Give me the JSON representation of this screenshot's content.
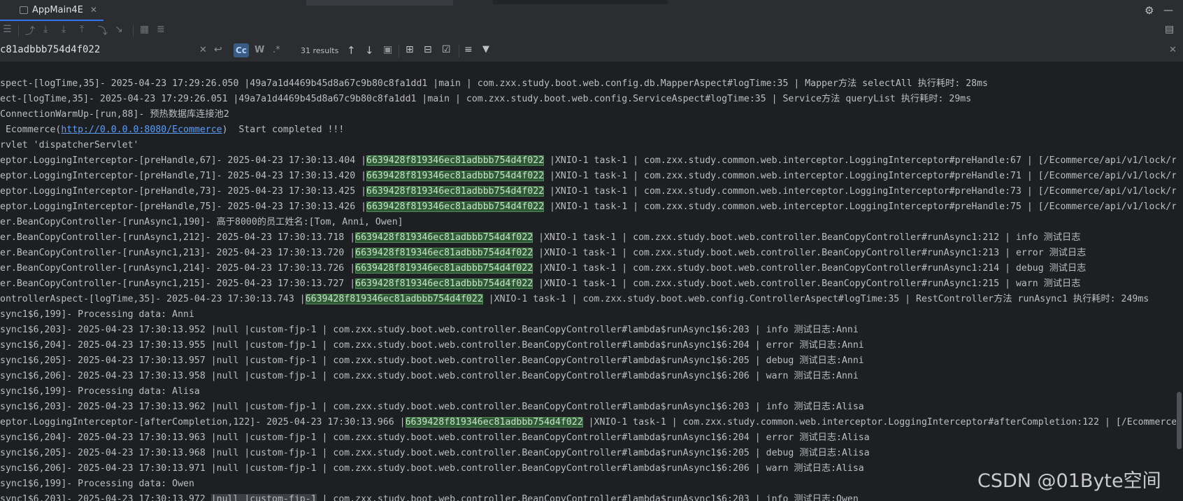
{
  "tab": {
    "title": "AppMain4E",
    "close": "✕"
  },
  "find": {
    "query": "c81adbbb754d4f022",
    "case_sensitive_label": "Cc",
    "words_label": "W",
    "regex_label": ".*",
    "results": "31 results"
  },
  "console": {
    "lines": [
      {
        "pre": "spect-[logTime,35]- 2025-04-23 17:29:26.050 |49a7a1d4469b45d8a67c9b80c8fa1dd1 |main | com.zxx.study.boot.web.config.db.MapperAspect#logTime:35 | Mapper方法 selectAll 执行耗时: 28ms"
      },
      {
        "pre": "ect-[logTime,35]- 2025-04-23 17:29:26.051 |49a7a1d4469b45d8a67c9b80c8fa1dd1 |main | com.zxx.study.boot.web.config.ServiceAspect#logTime:35 | Service方法 queryList 执行耗时: 29ms"
      },
      {
        "pre": "ConnectionWarmUp-[run,88]- 预热数据库连接池2"
      },
      {
        "pre": " Ecommerce(",
        "link": "http://0.0.0.0:8080/Ecommerce",
        "post": ")  Start completed !!!"
      },
      {
        "pre": "rvlet 'dispatcherServlet'"
      },
      {
        "pre": "eptor.LoggingInterceptor-[preHandle,67]- 2025-04-23 17:30:13.404 |",
        "hl": "6639428f819346ec81adbbb754d4f022",
        "post": " |XNIO-1 task-1 | com.zxx.study.common.web.interceptor.LoggingInterceptor#preHandle:67 | [/Ecommerce/api/v1/lock/r"
      },
      {
        "pre": "eptor.LoggingInterceptor-[preHandle,71]- 2025-04-23 17:30:13.420 |",
        "hl": "6639428f819346ec81adbbb754d4f022",
        "post": " |XNIO-1 task-1 | com.zxx.study.common.web.interceptor.LoggingInterceptor#preHandle:71 | [/Ecommerce/api/v1/lock/r"
      },
      {
        "pre": "eptor.LoggingInterceptor-[preHandle,73]- 2025-04-23 17:30:13.425 |",
        "hl": "6639428f819346ec81adbbb754d4f022",
        "post": " |XNIO-1 task-1 | com.zxx.study.common.web.interceptor.LoggingInterceptor#preHandle:73 | [/Ecommerce/api/v1/lock/r"
      },
      {
        "pre": "eptor.LoggingInterceptor-[preHandle,75]- 2025-04-23 17:30:13.426 |",
        "hl": "6639428f819346ec81adbbb754d4f022",
        "post": " |XNIO-1 task-1 | com.zxx.study.common.web.interceptor.LoggingInterceptor#preHandle:75 | [/Ecommerce/api/v1/lock/r"
      },
      {
        "pre": "er.BeanCopyController-[runAsync1,190]- 高于8000的员工姓名:[Tom, Anni, Owen]"
      },
      {
        "pre": "er.BeanCopyController-[runAsync1,212]- 2025-04-23 17:30:13.718 |",
        "hl": "6639428f819346ec81adbbb754d4f022",
        "post": " |XNIO-1 task-1 | com.zxx.study.boot.web.controller.BeanCopyController#runAsync1:212 | info 测试日志"
      },
      {
        "pre": "er.BeanCopyController-[runAsync1,213]- 2025-04-23 17:30:13.720 |",
        "hl": "6639428f819346ec81adbbb754d4f022",
        "post": " |XNIO-1 task-1 | com.zxx.study.boot.web.controller.BeanCopyController#runAsync1:213 | error 测试日志"
      },
      {
        "pre": "er.BeanCopyController-[runAsync1,214]- 2025-04-23 17:30:13.726 |",
        "hl": "6639428f819346ec81adbbb754d4f022",
        "post": " |XNIO-1 task-1 | com.zxx.study.boot.web.controller.BeanCopyController#runAsync1:214 | debug 测试日志"
      },
      {
        "pre": "er.BeanCopyController-[runAsync1,215]- 2025-04-23 17:30:13.727 |",
        "hl": "6639428f819346ec81adbbb754d4f022",
        "post": " |XNIO-1 task-1 | com.zxx.study.boot.web.controller.BeanCopyController#runAsync1:215 | warn 测试日志"
      },
      {
        "pre": "ontrollerAspect-[logTime,35]- 2025-04-23 17:30:13.743 |",
        "hl": "6639428f819346ec81adbbb754d4f022",
        "post": " |XNIO-1 task-1 | com.zxx.study.boot.web.config.ControllerAspect#logTime:35 | RestController方法 runAsync1 执行耗时: 249ms"
      },
      {
        "pre": "sync1$6,199]- Processing data: Anni"
      },
      {
        "pre": "sync1$6,203]- 2025-04-23 17:30:13.952 |null |custom-fjp-1 | com.zxx.study.boot.web.controller.BeanCopyController#lambda$runAsync1$6:203 | info 测试日志:Anni"
      },
      {
        "pre": "sync1$6,204]- 2025-04-23 17:30:13.955 |null |custom-fjp-1 | com.zxx.study.boot.web.controller.BeanCopyController#lambda$runAsync1$6:204 | error 测试日志:Anni"
      },
      {
        "pre": "sync1$6,205]- 2025-04-23 17:30:13.957 |null |custom-fjp-1 | com.zxx.study.boot.web.controller.BeanCopyController#lambda$runAsync1$6:205 | debug 测试日志:Anni"
      },
      {
        "pre": "sync1$6,206]- 2025-04-23 17:30:13.958 |null |custom-fjp-1 | com.zxx.study.boot.web.controller.BeanCopyController#lambda$runAsync1$6:206 | warn 测试日志:Anni"
      },
      {
        "pre": "sync1$6,199]- Processing data: Alisa"
      },
      {
        "pre": "sync1$6,203]- 2025-04-23 17:30:13.962 |null |custom-fjp-1 | com.zxx.study.boot.web.controller.BeanCopyController#lambda$runAsync1$6:203 | info 测试日志:Alisa"
      },
      {
        "pre": "eptor.LoggingInterceptor-[afterCompletion,122]- 2025-04-23 17:30:13.966 |",
        "hl": "6639428f819346ec81adbbb754d4f022",
        "post": " |XNIO-1 task-1 | com.zxx.study.common.web.interceptor.LoggingInterceptor#afterCompletion:122 | [/Ecommerce"
      },
      {
        "pre": "sync1$6,204]- 2025-04-23 17:30:13.963 |null |custom-fjp-1 | com.zxx.study.boot.web.controller.BeanCopyController#lambda$runAsync1$6:204 | error 测试日志:Alisa"
      },
      {
        "pre": "sync1$6,205]- 2025-04-23 17:30:13.968 |null |custom-fjp-1 | com.zxx.study.boot.web.controller.BeanCopyController#lambda$runAsync1$6:205 | debug 测试日志:Alisa"
      },
      {
        "pre": "sync1$6,206]- 2025-04-23 17:30:13.971 |null |custom-fjp-1 | com.zxx.study.boot.web.controller.BeanCopyController#lambda$runAsync1$6:206 | warn 测试日志:Alisa"
      },
      {
        "pre": "sync1$6,199]- Processing data: Owen"
      },
      {
        "pre": "sync1$6,203]- 2025-04-23 17:30:13.972 ",
        "hl": "|null |custom-fjp-1",
        "hl_style": "gray",
        "post": " | com.zxx.study.boot.web.controller.BeanCopyController#lambda$runAsync1$6:203 | info 测试日志:Owen"
      }
    ]
  },
  "watermark": "CSDN @01Byte空间",
  "colors": {
    "match_highlight": "#2e5a37",
    "link": "#5c9df5",
    "background": "#1e1f22"
  }
}
